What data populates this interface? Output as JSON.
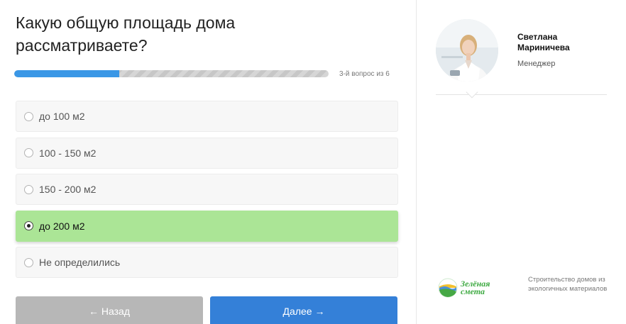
{
  "quiz": {
    "question": "Какую общую площадь дома рассматриваете?",
    "progress": {
      "fraction": 0.333,
      "label": "3-й вопрос из 6"
    },
    "options": [
      {
        "label": "до 100 м2",
        "selected": false
      },
      {
        "label": "100 - 150 м2",
        "selected": false
      },
      {
        "label": "150 - 200 м2",
        "selected": false
      },
      {
        "label": "до 200 м2",
        "selected": true
      },
      {
        "label": "Не определились",
        "selected": false
      }
    ],
    "back_label": "← Назад",
    "next_label": "Далее →"
  },
  "manager": {
    "name": "Светлана Мариничева",
    "role": "Менеджер"
  },
  "brand": {
    "logo_line1": "Зелёная",
    "logo_line2": "смета",
    "tagline": "Строительство домов из экологичных материалов"
  },
  "colors": {
    "accent": "#3480d8",
    "progress": "#3a97e6",
    "selected": "#abe596",
    "brand_green": "#3eaa42"
  }
}
